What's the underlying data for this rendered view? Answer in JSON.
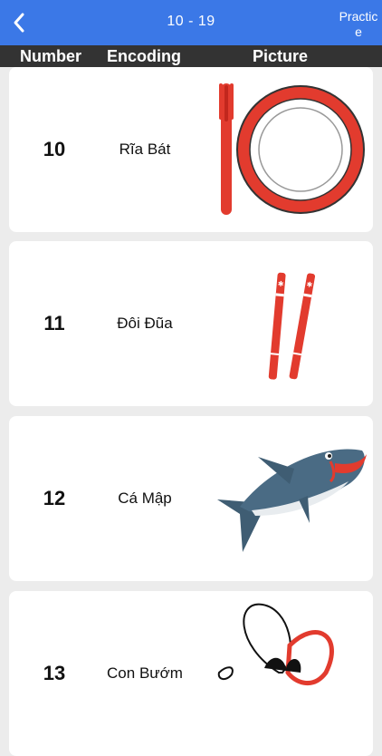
{
  "navbar": {
    "title": "10 - 19",
    "action_label": "Practice",
    "back_icon": "chevron-left-icon"
  },
  "columns": {
    "number": "Number",
    "encoding": "Encoding",
    "picture": "Picture"
  },
  "items": [
    {
      "number": "10",
      "encoding": "Rĩa Bát",
      "picture_icon": "fork-and-plate-icon"
    },
    {
      "number": "11",
      "encoding": "Đôi Đũa",
      "picture_icon": "chopsticks-icon"
    },
    {
      "number": "12",
      "encoding": "Cá Mập",
      "picture_icon": "shark-icon"
    },
    {
      "number": "13",
      "encoding": "Con Bướm",
      "picture_icon": "butterfly-icon"
    }
  ],
  "colors": {
    "navbar": "#3b78e7",
    "header_bar": "#333333",
    "accent_red": "#e23b2e"
  }
}
